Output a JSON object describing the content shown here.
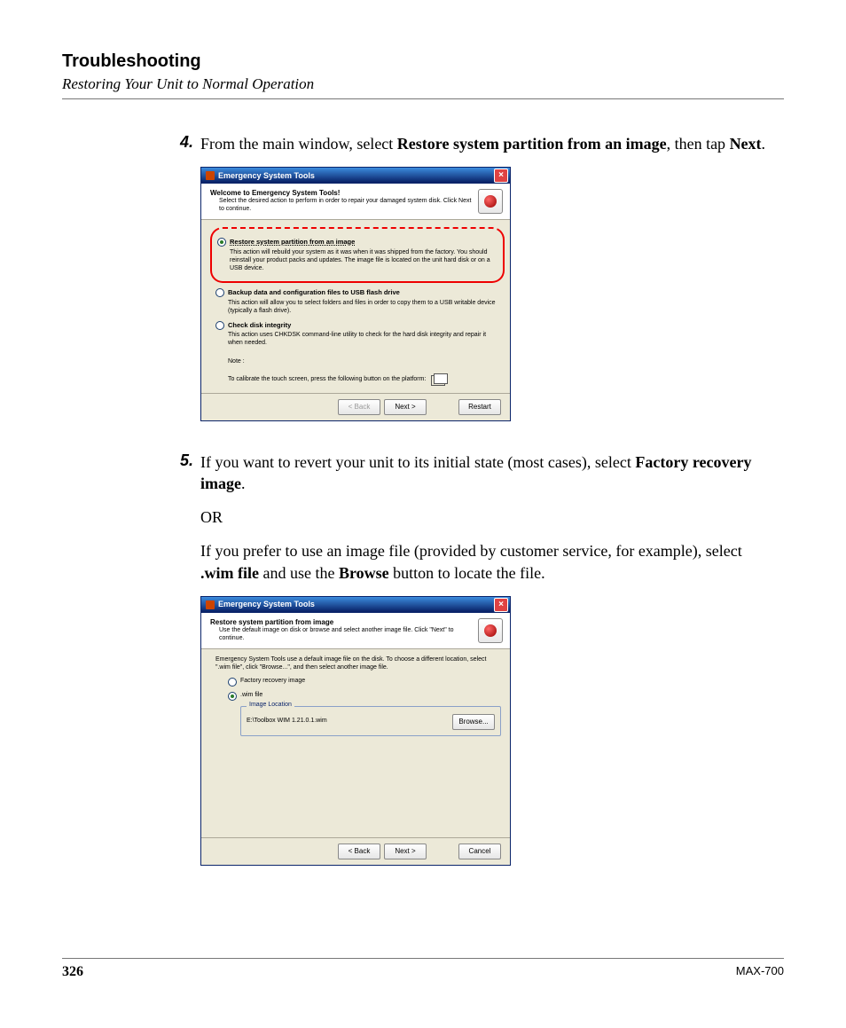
{
  "header": {
    "title": "Troubleshooting",
    "subtitle": "Restoring Your Unit to Normal Operation"
  },
  "steps": {
    "s4": {
      "num": "4.",
      "t1": "From the main window, select ",
      "b1": "Restore system partition from an image",
      "t2": ", then tap ",
      "b2": "Next",
      "t3": "."
    },
    "s5": {
      "num": "5.",
      "p1a": "If you want to revert your unit to its initial state (most cases), select ",
      "p1b": "Factory recovery image",
      "p1c": ".",
      "or": "OR",
      "p2a": "If you prefer to use an image file (provided by customer service, for example), select ",
      "p2b": ".wim file",
      "p2c": " and use the ",
      "p2d": "Browse",
      "p2e": " button to locate the file."
    }
  },
  "dlg1": {
    "title": "Emergency System Tools",
    "bt": "Welcome to Emergency System Tools!",
    "bd": "Select the desired action to perform in order to repair your damaged system disk. Click Next to continue.",
    "opt1": {
      "label": "Restore system partition from an image",
      "desc": "This action will rebuild your system as it was when it was shipped from the factory. You should reinstall your product packs and updates. The image file is located on the unit hard disk or on a USB device."
    },
    "opt2": {
      "label": "Backup data and configuration files to USB flash drive",
      "desc": "This action will allow you to select folders and files in order to copy them to a USB writable device (typically a flash drive)."
    },
    "opt3": {
      "label": "Check disk integrity",
      "desc": "This action uses CHKDSK command-line utility to check for the hard disk integrity and repair it when needed."
    },
    "noteLbl": "Note :",
    "noteTxt": "To calibrate the touch screen, press the following button on the platform:",
    "back": "< Back",
    "next": "Next >",
    "restart": "Restart"
  },
  "dlg2": {
    "title": "Emergency System Tools",
    "bt": "Restore system partition from image",
    "bd": "Use the default image on disk or browse and select another image file. Click \"Next\" to continue.",
    "intro": "Emergency System Tools use a default image file on the disk. To choose a different location, select \".wim file\", click \"Browse...\", and then select another image file.",
    "opt1": "Factory recovery image",
    "opt2": ".wim file",
    "legend": "Image Location",
    "path": "E:\\Toolbox WIM 1.21.0.1.wim",
    "browse": "Browse...",
    "back": "< Back",
    "next": "Next >",
    "cancel": "Cancel"
  },
  "footer": {
    "page": "326",
    "model": "MAX-700"
  }
}
